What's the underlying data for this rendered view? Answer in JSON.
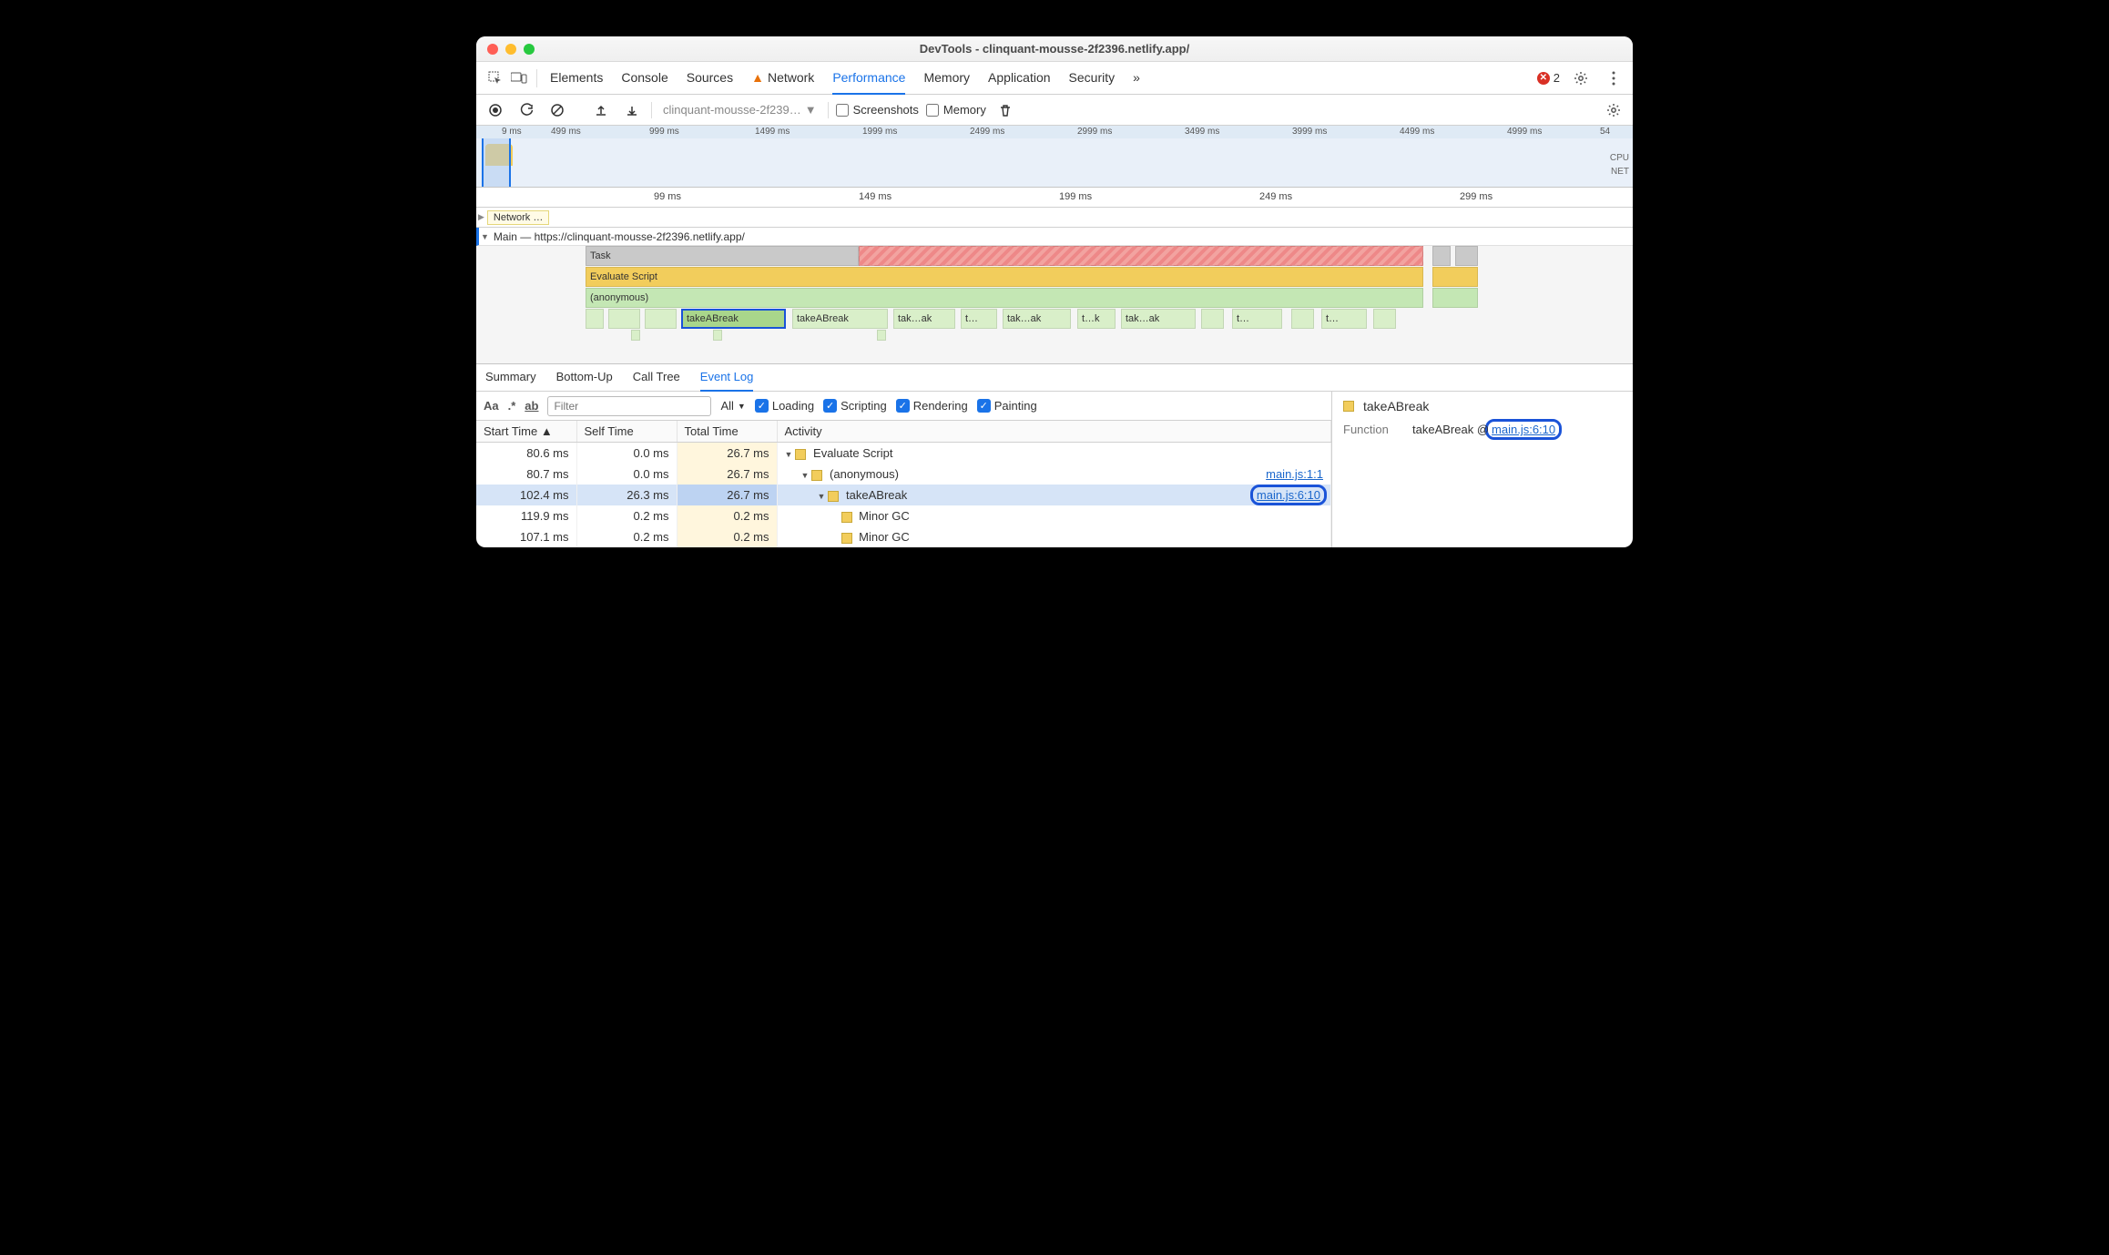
{
  "window": {
    "title": "DevTools - clinquant-mousse-2f2396.netlify.app/"
  },
  "mainTabs": {
    "items": [
      "Elements",
      "Console",
      "Sources",
      "Network",
      "Performance",
      "Memory",
      "Application",
      "Security"
    ],
    "activeIndex": 4,
    "networkWarning": true,
    "overflow": "»",
    "errorCount": "2"
  },
  "perfToolbar": {
    "profileName": "clinquant-mousse-2f239…",
    "screenshotsLabel": "Screenshots",
    "screenshotsChecked": false,
    "memoryLabel": "Memory",
    "memoryChecked": false
  },
  "overview": {
    "ticks": [
      "9 ms",
      "499 ms",
      "999 ms",
      "1499 ms",
      "1999 ms",
      "2499 ms",
      "2999 ms",
      "3499 ms",
      "3999 ms",
      "4499 ms",
      "4999 ms",
      "54"
    ],
    "rightLabels": [
      "CPU",
      "NET"
    ]
  },
  "detailTicks": [
    "99 ms",
    "149 ms",
    "199 ms",
    "249 ms",
    "299 ms"
  ],
  "networkLane": "Network …",
  "mainLane": {
    "label": "Main — https://clinquant-mousse-2f2396.netlify.app/",
    "rows": {
      "task": "Task",
      "eval": "Evaluate Script",
      "anon": "(anonymous)",
      "calls": [
        "takeABreak",
        "takeABreak",
        "tak…ak",
        "t…",
        "tak…ak",
        "t…k",
        "tak…ak",
        "t…",
        "t…"
      ]
    }
  },
  "bottomTabs": {
    "items": [
      "Summary",
      "Bottom-Up",
      "Call Tree",
      "Event Log"
    ],
    "activeIndex": 3
  },
  "filterBar": {
    "caseLabel": "Aa",
    "regexLabel": ".*",
    "wordLabel": "ab",
    "placeholder": "Filter",
    "scope": "All",
    "checks": [
      "Loading",
      "Scripting",
      "Rendering",
      "Painting"
    ]
  },
  "eventTable": {
    "headers": [
      "Start Time ▲",
      "Self Time",
      "Total Time",
      "Activity"
    ],
    "rows": [
      {
        "start": "80.6 ms",
        "self": "0.0 ms",
        "total": "26.7 ms",
        "indent": 0,
        "label": "Evaluate Script",
        "src": "",
        "tri": true
      },
      {
        "start": "80.7 ms",
        "self": "0.0 ms",
        "total": "26.7 ms",
        "indent": 1,
        "label": "(anonymous)",
        "src": "main.js:1:1",
        "tri": true
      },
      {
        "start": "102.4 ms",
        "self": "26.3 ms",
        "total": "26.7 ms",
        "indent": 2,
        "label": "takeABreak",
        "src": "main.js:6:10",
        "tri": true,
        "selected": true,
        "srcHl": true
      },
      {
        "start": "119.9 ms",
        "self": "0.2 ms",
        "total": "0.2 ms",
        "indent": 3,
        "label": "Minor GC",
        "src": "",
        "tri": false
      },
      {
        "start": "107.1 ms",
        "self": "0.2 ms",
        "total": "0.2 ms",
        "indent": 3,
        "label": "Minor GC",
        "src": "",
        "tri": false
      }
    ]
  },
  "detailPane": {
    "title": "takeABreak",
    "funcLabel": "Function",
    "funcName": "takeABreak",
    "at": "@",
    "srcLink": "main.js:6:10"
  }
}
